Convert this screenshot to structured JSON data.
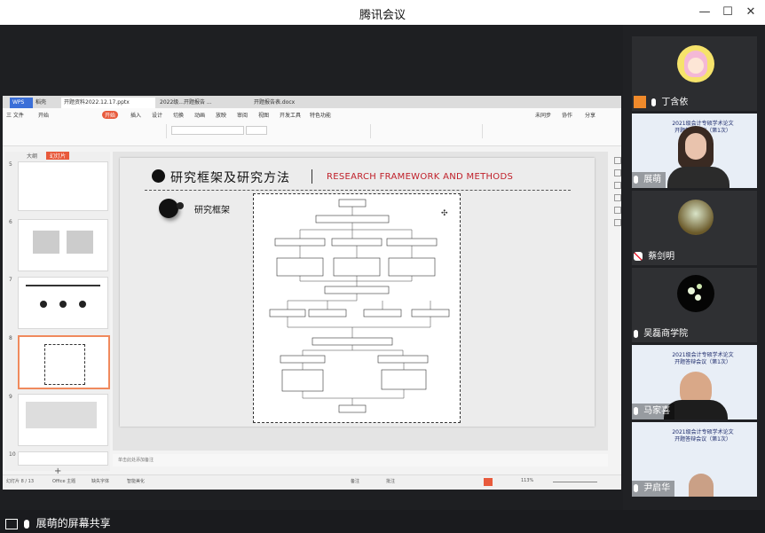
{
  "window": {
    "title": "腾讯会议",
    "controls": [
      "—",
      "☐",
      "✕"
    ]
  },
  "share_label": "展萌的屏幕共享",
  "tabs": [
    {
      "label": "WPS",
      "active": false
    },
    {
      "label": "稻壳",
      "active": false
    },
    {
      "label": "开题资料2022.12.17.pptx",
      "active": true
    },
    {
      "label": "2022级...开题报告 ...",
      "active": false
    },
    {
      "label": "开题报告表.docx",
      "active": false
    }
  ],
  "menu": [
    "三 文件",
    "开始",
    "插入",
    "设计",
    "切换",
    "动画",
    "放映",
    "审阅",
    "视图",
    "开发工具",
    "特色功能"
  ],
  "menu_hot": "开始",
  "ribbon_right": [
    "未同步",
    "协作",
    "分享"
  ],
  "thumb_tabs": [
    "大纲",
    "幻灯片"
  ],
  "thumb_numbers": [
    "5",
    "6",
    "7",
    "8",
    "9",
    "10"
  ],
  "slide": {
    "title_cn": "研究框架及研究方法",
    "title_en": "RESEARCH FRAMEWORK AND METHODS",
    "subtitle": "研究框架"
  },
  "notes_placeholder": "单击此处添加备注",
  "status": {
    "page": "幻灯片 8 / 13",
    "theme": "Office 主题",
    "missing_fonts": "缺失字体",
    "smart_beautify": "智能美化",
    "notes": "备注",
    "comments": "批注",
    "zoom": "113%"
  },
  "participants": [
    {
      "name": "丁含依",
      "muted": false,
      "avatar": "cartoon"
    },
    {
      "name": "展萌",
      "muted": false,
      "avatar": "video",
      "bg": "2021级会计专硕学术论文\n开题答辩会议（第1次）"
    },
    {
      "name": "蔡剑明",
      "muted": true,
      "avatar": "forest"
    },
    {
      "name": "吴磊商学院",
      "muted": false,
      "avatar": "flower"
    },
    {
      "name": "马家喜",
      "muted": false,
      "avatar": "video",
      "bg": "2021级会计专硕学术论文\n开题答辩会议（第1次）"
    },
    {
      "name": "尹启华",
      "muted": false,
      "avatar": "video",
      "bg": "2021级会计专硕学术论文\n开题答辩会议（第1次）"
    }
  ],
  "colors": {
    "accent": "#e85a3c",
    "slide_red": "#c0202a",
    "meeting_bg": "#202124"
  },
  "icons": [
    "mic-icon",
    "mic-muted-icon",
    "screen-share-icon",
    "minimize-icon",
    "maximize-icon",
    "close-icon"
  ]
}
